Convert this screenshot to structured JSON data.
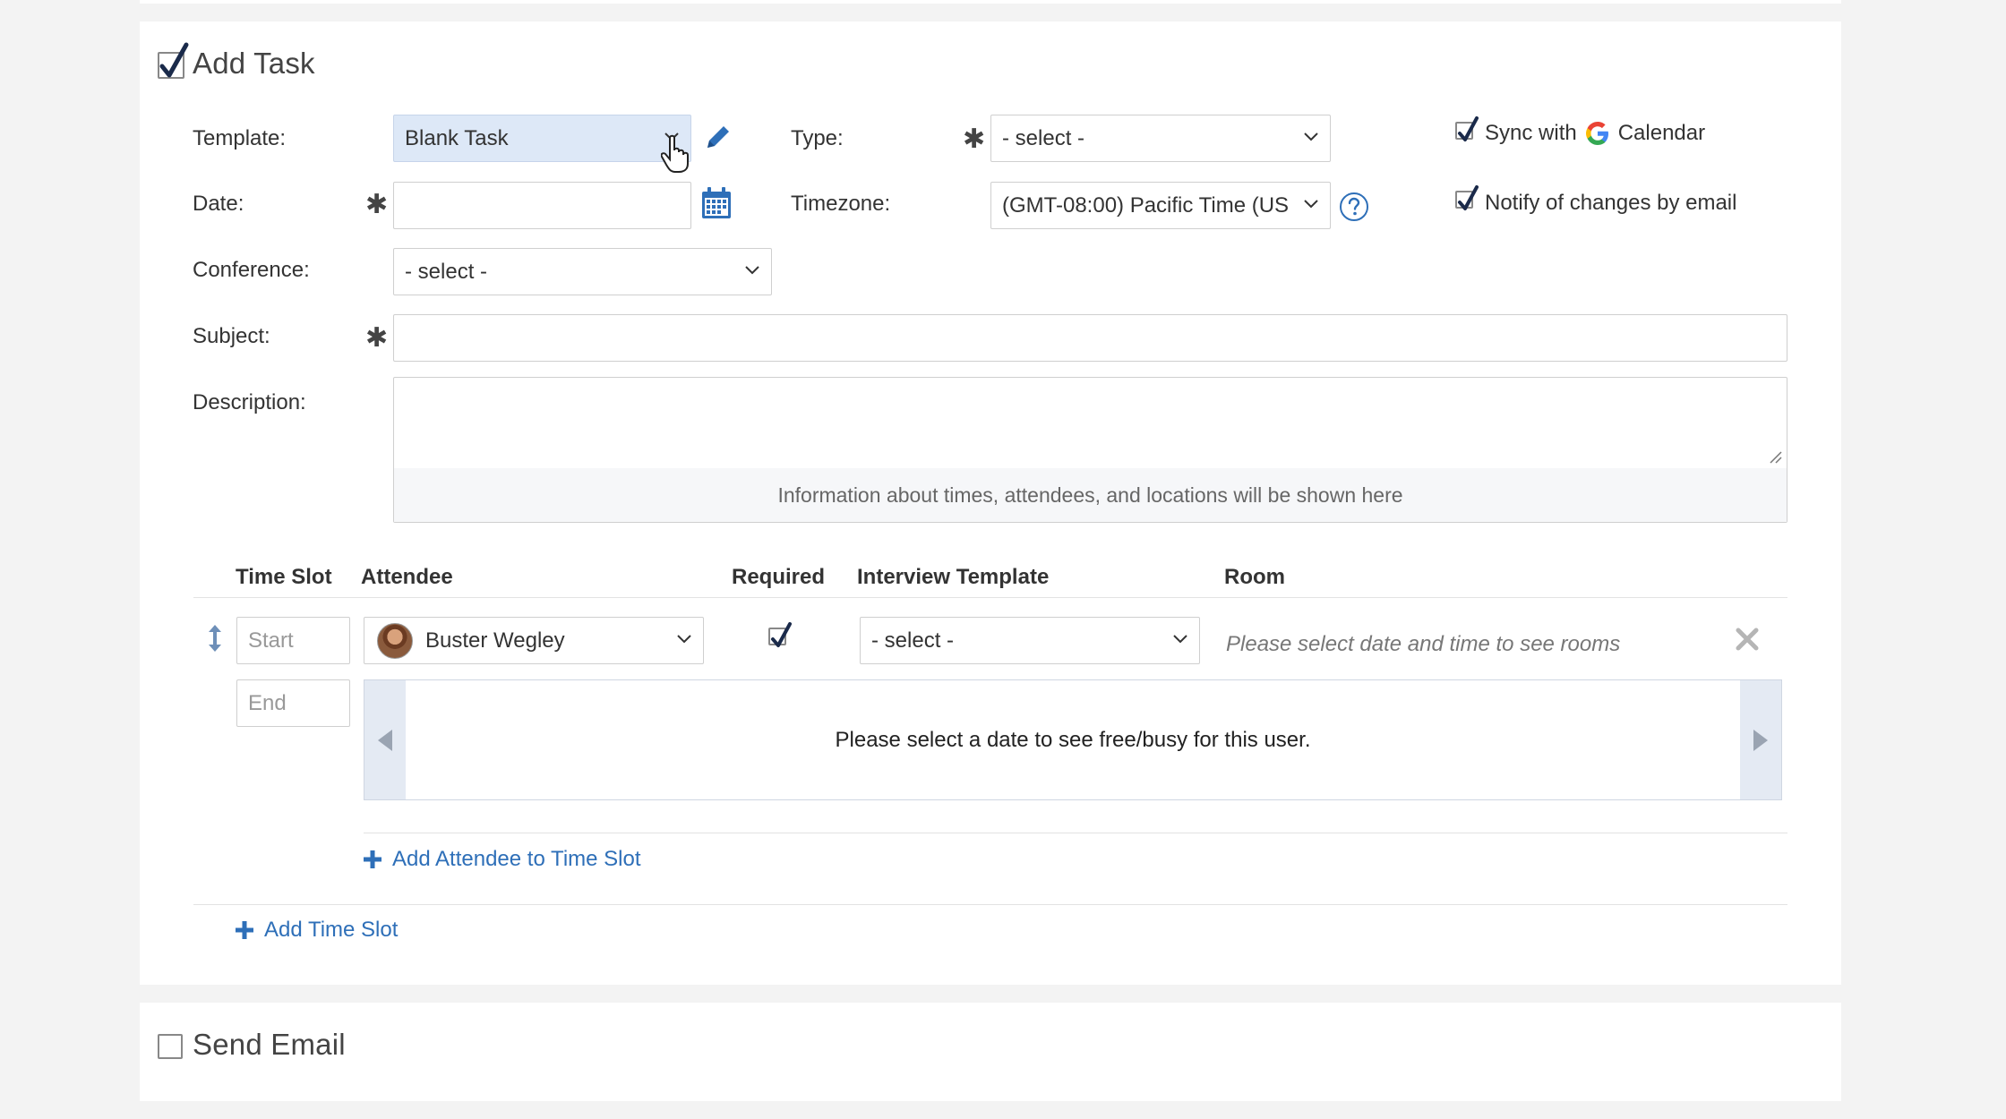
{
  "add_task": {
    "title": "Add Task",
    "checked": true
  },
  "form": {
    "template_label": "Template:",
    "template_value": "Blank Task",
    "type_label": "Type:",
    "type_value": "- select -",
    "date_label": "Date:",
    "date_value": "",
    "timezone_label": "Timezone:",
    "timezone_value": "(GMT-08:00) Pacific Time (US",
    "conference_label": "Conference:",
    "conference_value": "- select -",
    "subject_label": "Subject:",
    "subject_value": "",
    "description_label": "Description:",
    "description_value": "",
    "description_info": "Information about times, attendees, and locations will be shown here",
    "required_mark": "✱"
  },
  "options": {
    "sync_prefix": "Sync with",
    "sync_suffix": "Calendar",
    "notify_label": "Notify of changes by email",
    "sync_checked": true,
    "notify_checked": true
  },
  "slots_table": {
    "headers": {
      "time_slot": "Time Slot",
      "attendee": "Attendee",
      "required": "Required",
      "interview_template": "Interview Template",
      "room": "Room"
    },
    "row": {
      "start_placeholder": "Start",
      "end_placeholder": "End",
      "attendee_name": "Buster Wegley",
      "required_checked": true,
      "interview_template_value": "- select -",
      "room_message": "Please select date and time to see rooms",
      "freebusy_message": "Please select a date to see free/busy for this user."
    },
    "add_attendee_label": "Add Attendee to Time Slot",
    "add_time_slot_label": "Add Time Slot"
  },
  "send_email": {
    "title": "Send Email",
    "checked": false
  },
  "colors": {
    "accent_blue": "#2e6fb8",
    "template_highlight": "#dde8f7",
    "panel_bg": "#ffffff",
    "page_bg": "#f3f3f3"
  },
  "icons": [
    "checkbox-checked-icon",
    "chevron-down-icon",
    "pencil-icon",
    "calendar-icon",
    "help-icon",
    "google-g-icon",
    "drag-handle-icon",
    "remove-x-icon",
    "arrow-left-icon",
    "arrow-right-icon",
    "plus-icon",
    "hand-cursor-icon"
  ]
}
